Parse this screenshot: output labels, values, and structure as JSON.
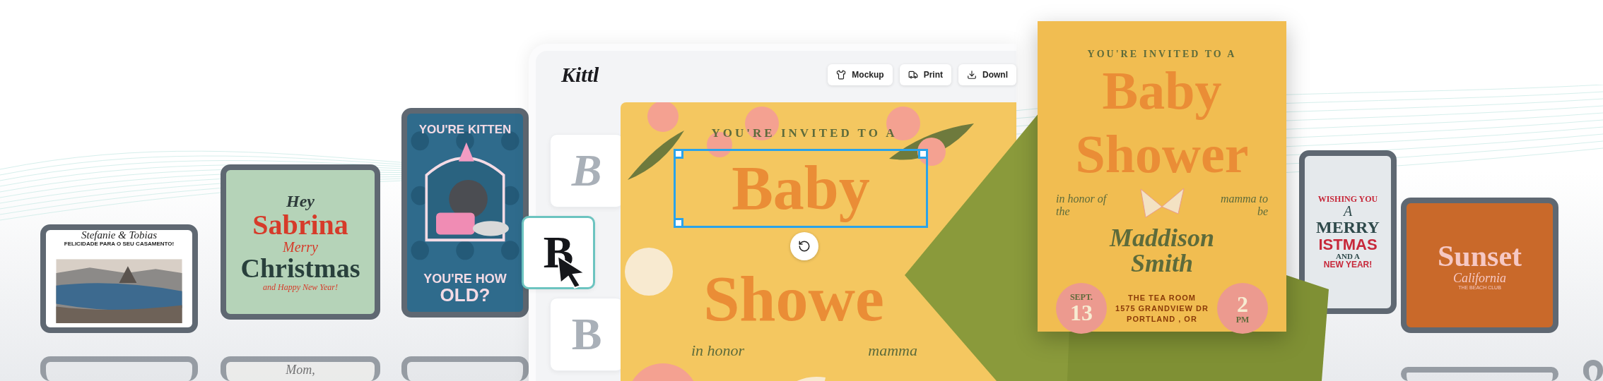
{
  "editor": {
    "logo": "Kittl",
    "actions": [
      {
        "label": "Mockup",
        "kind": "mockup"
      },
      {
        "label": "Print",
        "kind": "print"
      },
      {
        "label": "Downl",
        "kind": "download"
      }
    ],
    "font_options": [
      {
        "glyph": "B",
        "kind": "swash",
        "selected": false
      },
      {
        "glyph": "B",
        "kind": "bold",
        "selected": true
      },
      {
        "glyph": "B",
        "kind": "serif",
        "selected": false
      }
    ],
    "design": {
      "arc_text": "YOU'RE INVITED TO A",
      "title_1": "Baby",
      "title_2": "Showe",
      "left_note": "in honor",
      "right_note": "mamma"
    }
  },
  "invitation": {
    "arc_text": "YOU'RE INVITED TO A",
    "title_1": "Baby",
    "title_2": "Shower",
    "left_note": "in honor of the",
    "right_note": "mamma to be",
    "name_1": "Maddison",
    "name_2": "Smith",
    "date_label": "SEPT.",
    "date_day": "13",
    "address": [
      "THE TEA ROOM",
      "1575 GRANDVIEW DR",
      "PORTLAND , OR"
    ],
    "time": "2",
    "time_label": "PM"
  },
  "templates": [
    {
      "kind": "wedding",
      "texts": [
        "Stefanie & Tobias",
        "FELICIDADE PARA O SEU CASAMENTO!"
      ]
    },
    {
      "kind": "holiday",
      "texts": [
        "Hey",
        "Sabrina",
        "Merry",
        "Christmas",
        "and Happy New Year!"
      ]
    },
    {
      "kind": "birthday",
      "texts": [
        "YOU'RE KITTEN",
        "YOU'RE HOW",
        "OLD?"
      ]
    },
    {
      "kind": "greeting",
      "texts": [
        "WISHING YOU",
        "A",
        "MERRY",
        "ISTMAS",
        "AND A",
        "NEW YEAR!"
      ]
    },
    {
      "kind": "logo",
      "texts": [
        "Sunset",
        "California",
        "THE BEACH CLUB"
      ]
    }
  ],
  "lower_templates": [
    {
      "kind": "plain"
    },
    {
      "kind": "note",
      "texts": [
        "Mom,"
      ]
    },
    {
      "kind": "plain"
    },
    {
      "kind": "plain"
    },
    {
      "kind": "plain"
    }
  ]
}
